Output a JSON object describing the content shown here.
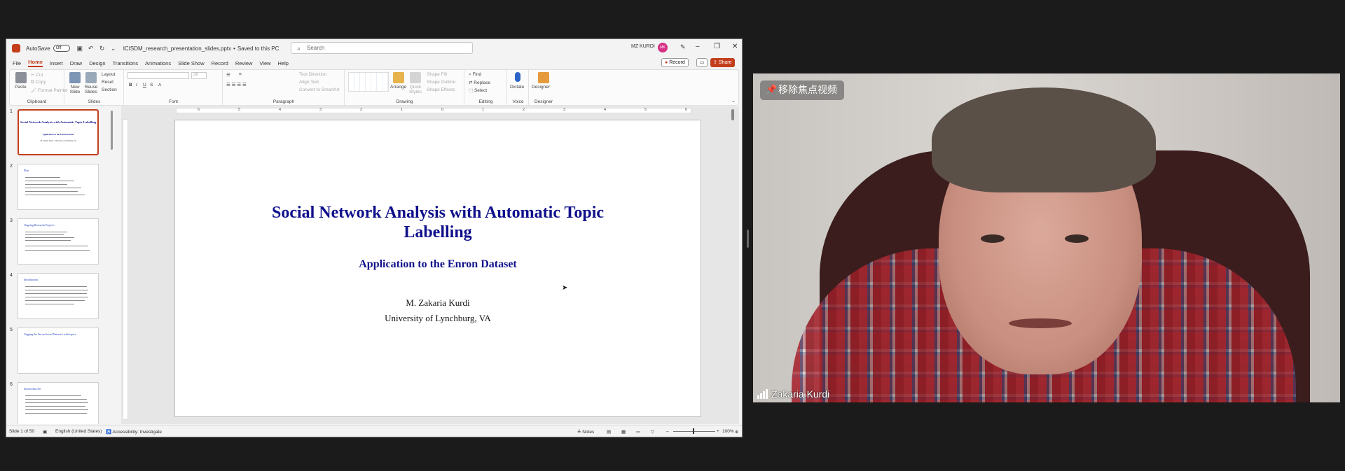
{
  "titlebar": {
    "autosave_label": "AutoSave",
    "autosave_state": "Off",
    "filename": "ICISDM_research_presentation_slides.pptx",
    "save_state": "Saved to this PC",
    "search_placeholder": "Search",
    "user_name": "MZ KURDI",
    "avatar_initials": "MK"
  },
  "menu": {
    "tabs": [
      "File",
      "Home",
      "Insert",
      "Draw",
      "Design",
      "Transitions",
      "Animations",
      "Slide Show",
      "Record",
      "Review",
      "View",
      "Help"
    ],
    "active_tab": "Home",
    "record_label": "Record",
    "share_label": "Share"
  },
  "ribbon": {
    "clipboard": {
      "label": "Clipboard",
      "paste": "Paste",
      "cut": "Cut",
      "copy": "Copy",
      "format_painter": "Format Painter"
    },
    "slides": {
      "label": "Slides",
      "new_slide": "New Slide",
      "reuse_slides": "Reuse Slides",
      "layout": "Layout",
      "reset": "Reset",
      "section": "Section"
    },
    "font": {
      "label": "Font",
      "size": "28"
    },
    "paragraph": {
      "label": "Paragraph",
      "text_direction": "Text Direction",
      "align_text": "Align Text",
      "smartart": "Convert to SmartArt"
    },
    "drawing": {
      "label": "Drawing",
      "arrange": "Arrange",
      "quick_styles": "Quick Styles",
      "shape_fill": "Shape Fill",
      "shape_outline": "Shape Outline",
      "shape_effects": "Shape Effects"
    },
    "editing": {
      "label": "Editing",
      "find": "Find",
      "replace": "Replace",
      "select": "Select"
    },
    "voice": {
      "label": "Voice",
      "dictate": "Dictate"
    },
    "designer": {
      "label": "Designer",
      "designer_btn": "Designer"
    }
  },
  "thumbnails": [
    {
      "num": "1",
      "title": "Social Network Analysis with Automatic Topic Labelling",
      "sub": "Application to the Enron Dataset",
      "author": "M. Zakaria Kurdi · University of Lynchburg, VA"
    },
    {
      "num": "2",
      "title": "Plan"
    },
    {
      "num": "3",
      "title": "Ongoing Research Projects"
    },
    {
      "num": "4",
      "title": "Introduction"
    },
    {
      "num": "5",
      "title": "Tagging the Enron Social Network with topics"
    },
    {
      "num": "6",
      "title": "Enron Data Set"
    }
  ],
  "slide": {
    "title_line1": "Social Network Analysis with Automatic Topic",
    "title_line2": "Labelling",
    "subtitle": "Application to the Enron Dataset",
    "author": "M. Zakaria Kurdi",
    "affiliation": "University of Lynchburg, VA"
  },
  "ruler": [
    "6",
    "5",
    "4",
    "3",
    "2",
    "1",
    "0",
    "1",
    "2",
    "3",
    "4",
    "5",
    "6"
  ],
  "statusbar": {
    "slide_info": "Slide 1 of 50",
    "language": "English (United States)",
    "accessibility": "Accessibility: Investigate",
    "notes": "Notes",
    "zoom": "100%"
  },
  "video": {
    "unpin_label": "移除焦点视频",
    "participant_name": "Zakaria Kurdi"
  }
}
